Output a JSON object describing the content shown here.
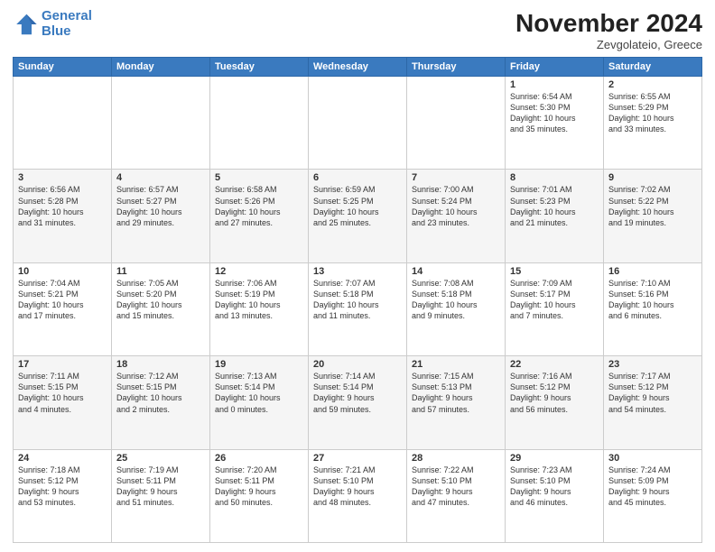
{
  "header": {
    "logo_line1": "General",
    "logo_line2": "Blue",
    "month": "November 2024",
    "location": "Zevgolateio, Greece"
  },
  "days_of_week": [
    "Sunday",
    "Monday",
    "Tuesday",
    "Wednesday",
    "Thursday",
    "Friday",
    "Saturday"
  ],
  "weeks": [
    [
      {
        "num": "",
        "info": ""
      },
      {
        "num": "",
        "info": ""
      },
      {
        "num": "",
        "info": ""
      },
      {
        "num": "",
        "info": ""
      },
      {
        "num": "",
        "info": ""
      },
      {
        "num": "1",
        "info": "Sunrise: 6:54 AM\nSunset: 5:30 PM\nDaylight: 10 hours\nand 35 minutes."
      },
      {
        "num": "2",
        "info": "Sunrise: 6:55 AM\nSunset: 5:29 PM\nDaylight: 10 hours\nand 33 minutes."
      }
    ],
    [
      {
        "num": "3",
        "info": "Sunrise: 6:56 AM\nSunset: 5:28 PM\nDaylight: 10 hours\nand 31 minutes."
      },
      {
        "num": "4",
        "info": "Sunrise: 6:57 AM\nSunset: 5:27 PM\nDaylight: 10 hours\nand 29 minutes."
      },
      {
        "num": "5",
        "info": "Sunrise: 6:58 AM\nSunset: 5:26 PM\nDaylight: 10 hours\nand 27 minutes."
      },
      {
        "num": "6",
        "info": "Sunrise: 6:59 AM\nSunset: 5:25 PM\nDaylight: 10 hours\nand 25 minutes."
      },
      {
        "num": "7",
        "info": "Sunrise: 7:00 AM\nSunset: 5:24 PM\nDaylight: 10 hours\nand 23 minutes."
      },
      {
        "num": "8",
        "info": "Sunrise: 7:01 AM\nSunset: 5:23 PM\nDaylight: 10 hours\nand 21 minutes."
      },
      {
        "num": "9",
        "info": "Sunrise: 7:02 AM\nSunset: 5:22 PM\nDaylight: 10 hours\nand 19 minutes."
      }
    ],
    [
      {
        "num": "10",
        "info": "Sunrise: 7:04 AM\nSunset: 5:21 PM\nDaylight: 10 hours\nand 17 minutes."
      },
      {
        "num": "11",
        "info": "Sunrise: 7:05 AM\nSunset: 5:20 PM\nDaylight: 10 hours\nand 15 minutes."
      },
      {
        "num": "12",
        "info": "Sunrise: 7:06 AM\nSunset: 5:19 PM\nDaylight: 10 hours\nand 13 minutes."
      },
      {
        "num": "13",
        "info": "Sunrise: 7:07 AM\nSunset: 5:18 PM\nDaylight: 10 hours\nand 11 minutes."
      },
      {
        "num": "14",
        "info": "Sunrise: 7:08 AM\nSunset: 5:18 PM\nDaylight: 10 hours\nand 9 minutes."
      },
      {
        "num": "15",
        "info": "Sunrise: 7:09 AM\nSunset: 5:17 PM\nDaylight: 10 hours\nand 7 minutes."
      },
      {
        "num": "16",
        "info": "Sunrise: 7:10 AM\nSunset: 5:16 PM\nDaylight: 10 hours\nand 6 minutes."
      }
    ],
    [
      {
        "num": "17",
        "info": "Sunrise: 7:11 AM\nSunset: 5:15 PM\nDaylight: 10 hours\nand 4 minutes."
      },
      {
        "num": "18",
        "info": "Sunrise: 7:12 AM\nSunset: 5:15 PM\nDaylight: 10 hours\nand 2 minutes."
      },
      {
        "num": "19",
        "info": "Sunrise: 7:13 AM\nSunset: 5:14 PM\nDaylight: 10 hours\nand 0 minutes."
      },
      {
        "num": "20",
        "info": "Sunrise: 7:14 AM\nSunset: 5:14 PM\nDaylight: 9 hours\nand 59 minutes."
      },
      {
        "num": "21",
        "info": "Sunrise: 7:15 AM\nSunset: 5:13 PM\nDaylight: 9 hours\nand 57 minutes."
      },
      {
        "num": "22",
        "info": "Sunrise: 7:16 AM\nSunset: 5:12 PM\nDaylight: 9 hours\nand 56 minutes."
      },
      {
        "num": "23",
        "info": "Sunrise: 7:17 AM\nSunset: 5:12 PM\nDaylight: 9 hours\nand 54 minutes."
      }
    ],
    [
      {
        "num": "24",
        "info": "Sunrise: 7:18 AM\nSunset: 5:12 PM\nDaylight: 9 hours\nand 53 minutes."
      },
      {
        "num": "25",
        "info": "Sunrise: 7:19 AM\nSunset: 5:11 PM\nDaylight: 9 hours\nand 51 minutes."
      },
      {
        "num": "26",
        "info": "Sunrise: 7:20 AM\nSunset: 5:11 PM\nDaylight: 9 hours\nand 50 minutes."
      },
      {
        "num": "27",
        "info": "Sunrise: 7:21 AM\nSunset: 5:10 PM\nDaylight: 9 hours\nand 48 minutes."
      },
      {
        "num": "28",
        "info": "Sunrise: 7:22 AM\nSunset: 5:10 PM\nDaylight: 9 hours\nand 47 minutes."
      },
      {
        "num": "29",
        "info": "Sunrise: 7:23 AM\nSunset: 5:10 PM\nDaylight: 9 hours\nand 46 minutes."
      },
      {
        "num": "30",
        "info": "Sunrise: 7:24 AM\nSunset: 5:09 PM\nDaylight: 9 hours\nand 45 minutes."
      }
    ]
  ]
}
